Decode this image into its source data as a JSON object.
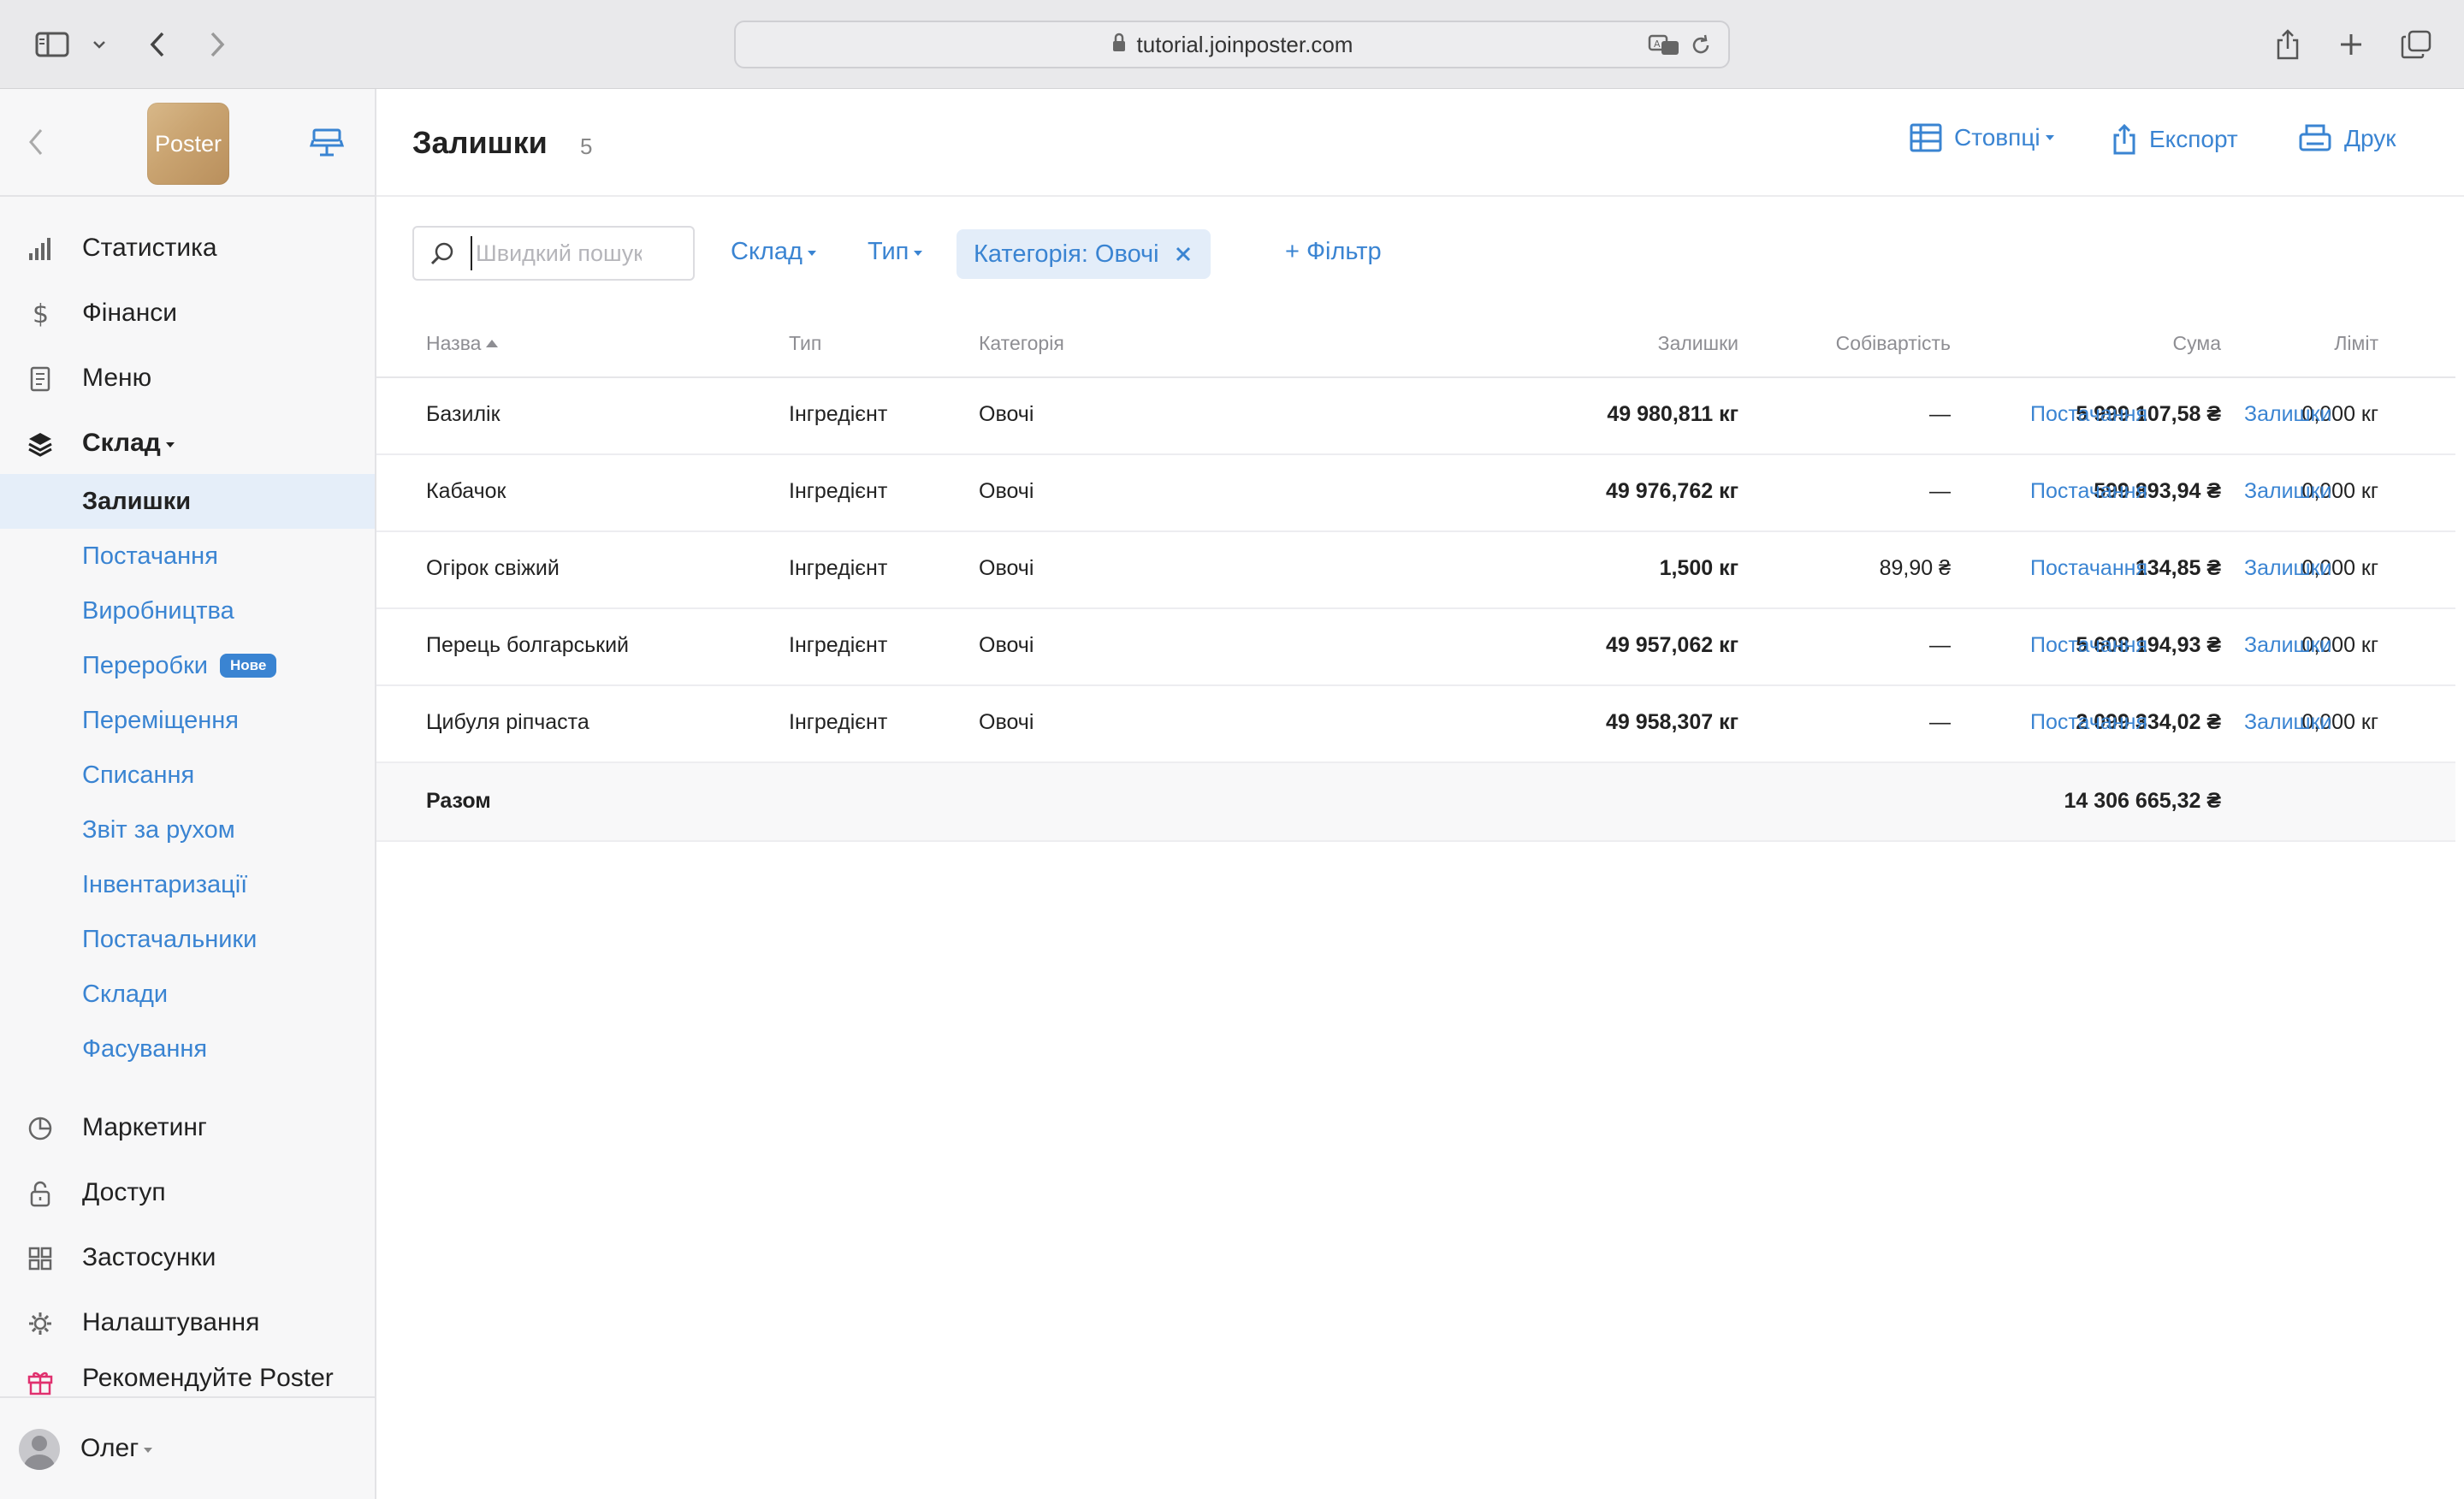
{
  "browser": {
    "url": "tutorial.joinposter.com"
  },
  "sidebar": {
    "logo_text": "Poster",
    "main_items": [
      {
        "label": "Статистика",
        "icon": "bar-chart-icon"
      },
      {
        "label": "Фінанси",
        "icon": "dollar-icon"
      },
      {
        "label": "Меню",
        "icon": "document-icon"
      },
      {
        "label": "Склад",
        "icon": "layers-icon"
      }
    ],
    "sub_items": [
      {
        "label": "Залишки",
        "active": true
      },
      {
        "label": "Постачання"
      },
      {
        "label": "Виробництва"
      },
      {
        "label": "Переробки",
        "badge": "Нове"
      },
      {
        "label": "Переміщення"
      },
      {
        "label": "Списання"
      },
      {
        "label": "Звіт за рухом"
      },
      {
        "label": "Інвентаризації"
      },
      {
        "label": "Постачальники"
      },
      {
        "label": "Склади"
      },
      {
        "label": "Фасування"
      }
    ],
    "bottom_items": [
      {
        "label": "Маркетинг",
        "icon": "pie-chart-icon"
      },
      {
        "label": "Доступ",
        "icon": "lock-icon"
      },
      {
        "label": "Застосунки",
        "icon": "grid-icon"
      },
      {
        "label": "Налаштування",
        "icon": "gear-icon"
      },
      {
        "label": "Рекомендуйте Poster",
        "icon": "gift-icon"
      }
    ],
    "user_name": "Олег"
  },
  "header": {
    "title": "Залишки",
    "count": "5",
    "columns_label": "Стовпці",
    "export_label": "Експорт",
    "print_label": "Друк"
  },
  "filters": {
    "search_placeholder": "Швидкий пошук",
    "warehouse_label": "Склад",
    "type_label": "Тип",
    "category_chip": "Категорія: Овочі",
    "add_filter_label": "+ Фільтр"
  },
  "table": {
    "headers": {
      "name": "Назва",
      "type": "Тип",
      "category": "Категорія",
      "stock": "Залишки",
      "cost": "Собівартість",
      "sum": "Сума",
      "limit": "Ліміт"
    },
    "rows": [
      {
        "name": "Базилік",
        "type": "Інгредієнт",
        "category": "Овочі",
        "stock": "49 980,811 кг",
        "cost": "—",
        "sum": "5 999 107,58 ₴",
        "limit": "0,000 кг",
        "link1": "Постачання",
        "link2": "Залишки"
      },
      {
        "name": "Кабачок",
        "type": "Інгредієнт",
        "category": "Овочі",
        "stock": "49 976,762 кг",
        "cost": "—",
        "sum": "599 893,94 ₴",
        "limit": "0,000 кг",
        "link1": "Постачання",
        "link2": "Залишки"
      },
      {
        "name": "Огірок свіжий",
        "type": "Інгредієнт",
        "category": "Овочі",
        "stock": "1,500 кг",
        "cost": "89,90 ₴",
        "sum": "134,85 ₴",
        "limit": "0,000 кг",
        "link1": "Постачання",
        "link2": "Залишки"
      },
      {
        "name": "Перець болгарський",
        "type": "Інгредієнт",
        "category": "Овочі",
        "stock": "49 957,062 кг",
        "cost": "—",
        "sum": "5 608 194,93 ₴",
        "limit": "0,000 кг",
        "link1": "Постачання",
        "link2": "Залишки"
      },
      {
        "name": "Цибуля ріпчаста",
        "type": "Інгредієнт",
        "category": "Овочі",
        "stock": "49 958,307 кг",
        "cost": "—",
        "sum": "2 099 334,02 ₴",
        "limit": "0,000 кг",
        "link1": "Постачання",
        "link2": "Залишки"
      }
    ],
    "total": {
      "label": "Разом",
      "sum": "14 306 665,32 ₴"
    }
  },
  "colors": {
    "accent": "#3a84d2",
    "active_bg": "#e5eef9",
    "gift": "#e0306e"
  }
}
